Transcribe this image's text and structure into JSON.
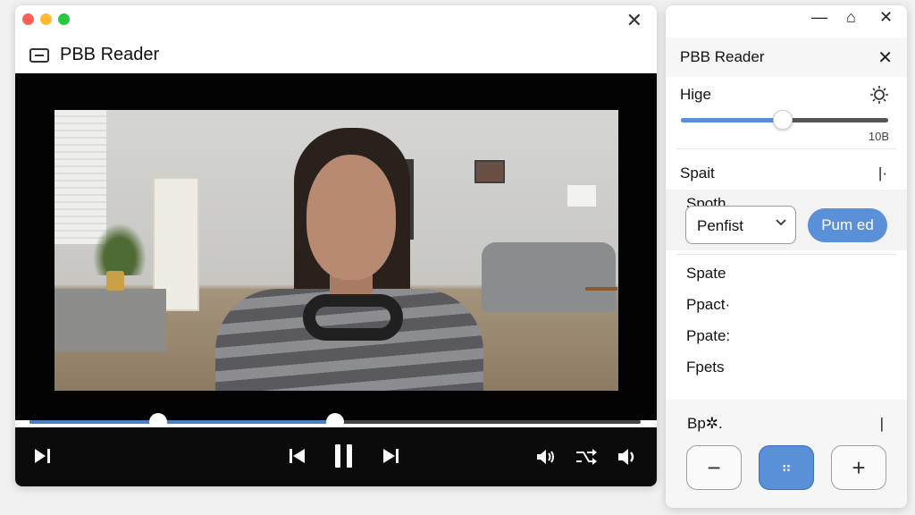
{
  "main_window": {
    "title": "PBB Reader",
    "close_glyph": "✕"
  },
  "playback": {
    "progress_fraction": 0.5,
    "marker_fractions": [
      0.21,
      0.5
    ]
  },
  "controls": {
    "skip_to_end_icon": "skip-to-end-icon",
    "previous_icon": "previous-icon",
    "pause_icon": "pause-icon",
    "next_icon": "next-icon",
    "volume_icon": "volume-icon",
    "shuffle_icon": "shuffle-icon",
    "speaker_icon": "speaker-icon"
  },
  "panel": {
    "titlebar": {
      "minimize": "—",
      "maximize": "⌂",
      "close": "✕"
    },
    "title": "PBB Reader",
    "close_glyph": "✕",
    "slider": {
      "label": "Hige",
      "value_label": "10B",
      "fraction": 0.49
    },
    "spait": {
      "label": "Spait",
      "end_mark": "|·"
    },
    "spoth": {
      "label": "Spoth",
      "select_value": "Penfist",
      "button_label": "Pum ed"
    },
    "list": [
      "Spate",
      "Ppact·",
      "Ppate:",
      "Fpets"
    ],
    "bottom": {
      "label": "Bp✲.",
      "end_mark": "|",
      "minus": "−",
      "middle": "⠶",
      "plus": "+"
    }
  },
  "colors": {
    "accent": "#5a90d8",
    "progress": "#4a7fc8",
    "video_bg": "#030303",
    "control_bar": "#0b0b0b"
  }
}
